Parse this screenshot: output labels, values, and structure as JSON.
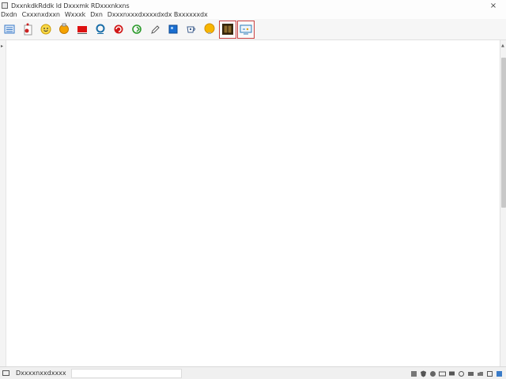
{
  "window": {
    "title": "DxxnkdkRddk ld Dxxxmk RDxxxnkxns",
    "close_glyph": "×"
  },
  "menu": {
    "items": [
      {
        "label": "Dxdn"
      },
      {
        "label": "Cxxxnxdxxn"
      },
      {
        "label": "Wxxxk"
      },
      {
        "label": "Dxn"
      },
      {
        "label": "Dxxxnxxxdxxxxdxdx Bxxxxxxdx"
      }
    ]
  },
  "toolbar": {
    "buttons": [
      {
        "icon": "window-list-icon",
        "color": "#3a7bc8"
      },
      {
        "icon": "document-pin-icon",
        "color": "#cc2222"
      },
      {
        "icon": "smiley-icon",
        "color": "#e0b000"
      },
      {
        "icon": "orange-circle-icon",
        "color": "#f0a000"
      },
      {
        "icon": "red-rectangle-icon",
        "color": "#dd1111"
      },
      {
        "icon": "blue-ring-icon",
        "color": "#1a6ea8"
      },
      {
        "icon": "red-circle-arrow-icon",
        "color": "#d01818"
      },
      {
        "icon": "green-refresh-icon",
        "color": "#2a9a2a"
      },
      {
        "icon": "pencil-icon",
        "color": "#666666"
      },
      {
        "icon": "blue-square-icon",
        "color": "#1a6ed0"
      },
      {
        "icon": "cup-icon",
        "color": "#3a5a8a"
      },
      {
        "icon": "yellow-bulb-icon",
        "color": "#f5b000"
      },
      {
        "icon": "book-icon",
        "color": "#6b4a1f"
      },
      {
        "icon": "monitor-note-icon",
        "color": "#2a7ab8"
      }
    ]
  },
  "statusbar": {
    "label": "Dxxxxnxxdxxxx",
    "left_icon": "connection-icon"
  },
  "tray": {
    "icons": [
      "network-icon",
      "shield-icon",
      "bell-icon",
      "mail-icon",
      "monitor-icon",
      "keyboard-icon",
      "clock-icon",
      "folder-icon",
      "speaker-icon",
      "info-icon"
    ]
  }
}
